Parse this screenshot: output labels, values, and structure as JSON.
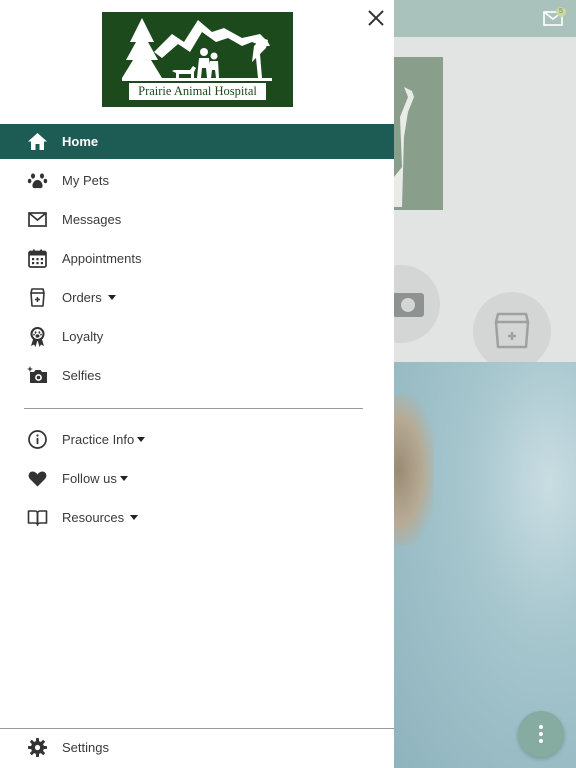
{
  "header": {
    "mail_badge": "5"
  },
  "logo": {
    "text": "Prairie Animal Hospital"
  },
  "menu": {
    "items": [
      {
        "label": "Home",
        "icon": "home-icon",
        "active": true
      },
      {
        "label": "My Pets",
        "icon": "paw-icon"
      },
      {
        "label": "Messages",
        "icon": "envelope-icon"
      },
      {
        "label": "Appointments",
        "icon": "calendar-icon"
      },
      {
        "label": "Orders",
        "icon": "pet-food-bag-icon",
        "dropdown": true
      },
      {
        "label": "Loyalty",
        "icon": "award-ribbon-icon"
      },
      {
        "label": "Selfies",
        "icon": "camera-sparkle-icon"
      }
    ],
    "secondary": [
      {
        "label": "Practice Info",
        "icon": "info-icon",
        "dropdown": true
      },
      {
        "label": "Follow us",
        "icon": "heart-icon",
        "dropdown": true
      },
      {
        "label": "Resources",
        "icon": "book-icon",
        "dropdown": true
      }
    ],
    "settings": {
      "label": "Settings",
      "icon": "gear-icon"
    }
  },
  "colors": {
    "active_bg": "#1d5c55",
    "logo_bg": "#1d4a1c",
    "header_bg": "#a9c2bc",
    "fab": "#86aba1"
  }
}
